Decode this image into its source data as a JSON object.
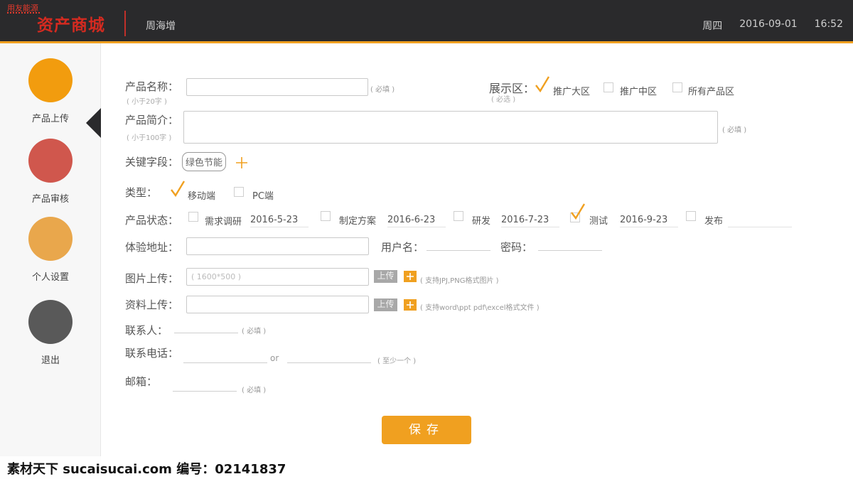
{
  "header": {
    "logo_small": "用友能源",
    "logo_main": "资产商城",
    "user_name": "周海增",
    "weekday": "周四",
    "date": "2016-09-01",
    "time": "16:52"
  },
  "sidebar": {
    "items": [
      {
        "label": "产品上传",
        "color": "#f29c0e"
      },
      {
        "label": "产品审核",
        "color": "#d0574d"
      },
      {
        "label": "个人设置",
        "color": "#e9a74c"
      },
      {
        "label": "退出",
        "color": "#595959"
      }
    ]
  },
  "form": {
    "name_label": "产品名称：",
    "name_sub": "( 小于20字 )",
    "name_hint": "( 必填 )",
    "display_label": "展示区：",
    "display_sub": "( 必选 )",
    "display_options": [
      {
        "label": "推广大区",
        "checked": true
      },
      {
        "label": "推广中区",
        "checked": false
      },
      {
        "label": "所有产品区",
        "checked": false
      }
    ],
    "intro_label": "产品简介：",
    "intro_sub": "( 小于100字 )",
    "intro_hint": "( 必填 )",
    "keyword_label": "关键字段：",
    "keyword_tag": "绿色节能",
    "type_label": "类型：",
    "type_options": [
      {
        "label": "移动端",
        "checked": true
      },
      {
        "label": "PC端",
        "checked": false
      }
    ],
    "status_label": "产品状态：",
    "status_items": [
      {
        "label": "需求调研",
        "date": "2016-5-23",
        "checked": false
      },
      {
        "label": "制定方案",
        "date": "2016-6-23",
        "checked": false
      },
      {
        "label": "研发",
        "date": "2016-7-23",
        "checked": false
      },
      {
        "label": "测试",
        "date": "2016-9-23",
        "checked": true
      },
      {
        "label": "发布",
        "date": "",
        "checked": false
      }
    ],
    "url_label": "体验地址：",
    "username_label": "用户名：",
    "password_label": "密码：",
    "image_label": "图片上传：",
    "image_placeholder": "( 1600*500 )",
    "upload_label": "上传",
    "image_hint": "( 支持JPJ,PNG格式图片 )",
    "file_label": "资料上传：",
    "file_hint": "( 支持word\\ppt pdf\\excel格式文件 )",
    "contact_label": "联系人：",
    "contact_hint": "( 必填 )",
    "phone_label": "联系电话：",
    "phone_or": "or",
    "phone_hint": "( 至少一个 )",
    "email_label": "邮箱：",
    "email_hint": "( 必填 )",
    "save_label": "保存"
  },
  "watermark": {
    "text": "素材天下 sucaisucai.com  编号：02141837"
  },
  "colors": {
    "accent": "#f0a020",
    "header_bg": "#2a2a2c",
    "logo_red": "#d42a20"
  }
}
